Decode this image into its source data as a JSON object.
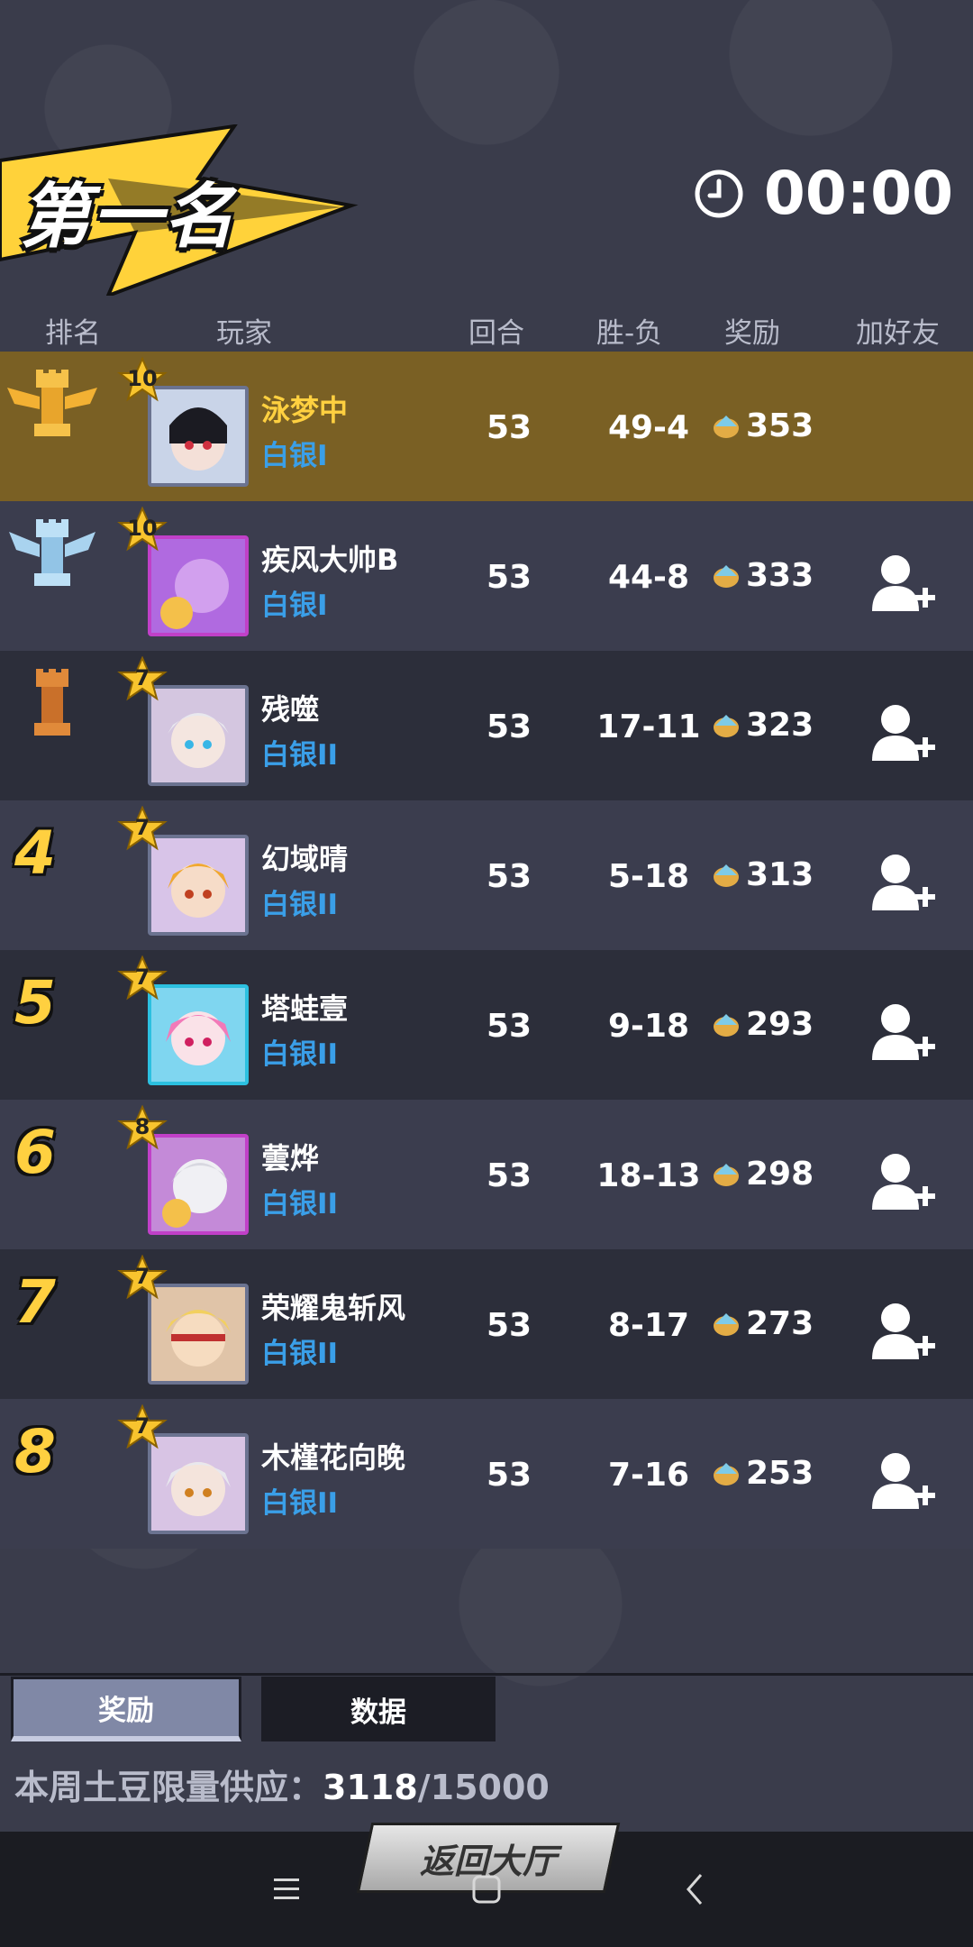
{
  "title": "第一名",
  "timer": "00:00",
  "header": {
    "rank": "排名",
    "player": "玩家",
    "rounds": "回合",
    "wl": "胜-负",
    "reward": "奖励",
    "add_friend": "加好友"
  },
  "rows": [
    {
      "rank": "1",
      "level": "10",
      "name": "泳梦中",
      "tier": "白银I",
      "rounds": "53",
      "wl": "49-4",
      "reward": "353"
    },
    {
      "rank": "2",
      "level": "10",
      "name": "疾风大帅B",
      "tier": "白银I",
      "rounds": "53",
      "wl": "44-8",
      "reward": "333"
    },
    {
      "rank": "3",
      "level": "7",
      "name": "残噬",
      "tier": "白银II",
      "rounds": "53",
      "wl": "17-11",
      "reward": "323"
    },
    {
      "rank": "4",
      "level": "7",
      "name": "幻域晴",
      "tier": "白银II",
      "rounds": "53",
      "wl": "5-18",
      "reward": "313"
    },
    {
      "rank": "5",
      "level": "7",
      "name": "塔蛙壹",
      "tier": "白银II",
      "rounds": "53",
      "wl": "9-18",
      "reward": "293"
    },
    {
      "rank": "6",
      "level": "8",
      "name": "蕓烨",
      "tier": "白银II",
      "rounds": "53",
      "wl": "18-13",
      "reward": "298"
    },
    {
      "rank": "7",
      "level": "7",
      "name": "荣耀鬼斩风",
      "tier": "白银II",
      "rounds": "53",
      "wl": "8-17",
      "reward": "273"
    },
    {
      "rank": "8",
      "level": "7",
      "name": "木槿花向晚",
      "tier": "白银II",
      "rounds": "53",
      "wl": "7-16",
      "reward": "253"
    }
  ],
  "tabs": {
    "reward": "奖励",
    "data": "数据"
  },
  "supply": {
    "label": "本周土豆限量供应：",
    "current": "3118",
    "total": "/15000"
  },
  "return_button": "返回大厅",
  "colors": {
    "gold_row": "#7a6024",
    "tier_blue": "#3a9fe8",
    "rank_yellow": "#ffd040"
  },
  "icons": {
    "timer": "clock-icon",
    "reward": "potato-icon",
    "add_friend": "add-friend-icon",
    "rank1": "gold-rook-icon",
    "rank2": "silver-rook-icon",
    "rank3": "bronze-rook-icon"
  }
}
